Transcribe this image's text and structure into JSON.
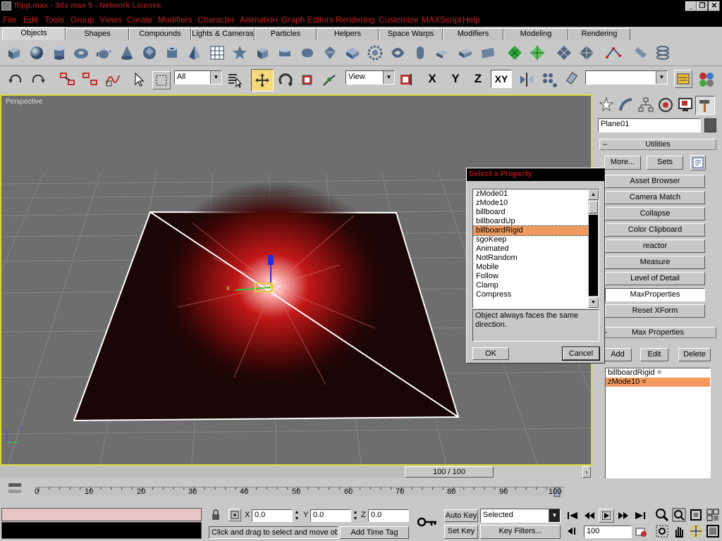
{
  "window": {
    "title": "flipp.max - 3ds max 5 - Network License",
    "min": "_",
    "restore": "❐",
    "close": "✕"
  },
  "menu": [
    "File",
    "Edit",
    "Tools",
    "Group",
    "Views",
    "Create",
    "Modifiers",
    "Character",
    "Animation",
    "Graph Editors",
    "Rendering",
    "Customize",
    "MAXScript",
    "Help"
  ],
  "tabs": [
    "Objects",
    "Shapes",
    "Compounds",
    "Lights & Cameras",
    "Particles",
    "Helpers",
    "Space Warps",
    "Modifiers",
    "Modeling",
    "Rendering"
  ],
  "toolbar": {
    "selection_filter": "All",
    "coord_system": "View",
    "axis_x": "X",
    "axis_y": "Y",
    "axis_z": "Z",
    "axis_xy": "XY",
    "named_selection": ""
  },
  "viewport": {
    "label": "Perspective"
  },
  "command_panel": {
    "object_name": "Plane01",
    "utilities_title": "Utilities",
    "more_label": "More...",
    "sets_label": "Sets",
    "utilities": [
      "Asset Browser",
      "Camera Match",
      "Collapse",
      "Color Clipboard",
      "reactor",
      "Measure",
      "Level of Detail",
      "MaxProperties",
      "Reset XForm"
    ],
    "maxprops_title": "Max Properties",
    "add_label": "Add",
    "edit_label": "Edit",
    "delete_label": "Delete",
    "assigned": [
      "billboardRigid =",
      "zMode10 ="
    ]
  },
  "dialog": {
    "title": "Select a Property",
    "items": [
      "zMode01",
      "zMode10",
      "billboard",
      "billboardUp",
      "billboardRigid",
      "sgoKeep",
      "Animated",
      "NotRandom",
      "Mobile",
      "Follow",
      "Clamp",
      "Compress"
    ],
    "selected": "billboardRigid",
    "description": "Object always faces the same direction.",
    "ok": "OK",
    "cancel": "Cancel"
  },
  "timeline": {
    "frame": "100 / 100",
    "ticks": [
      "0",
      "10",
      "20",
      "30",
      "40",
      "50",
      "60",
      "70",
      "80",
      "90",
      "100"
    ],
    "position_fraction": 1.0
  },
  "status": {
    "prompt": "Click and drag to select and move obj",
    "add_time_tag": "Add Time Tag",
    "x_label": "X",
    "x": "0.0",
    "y_label": "Y",
    "y": "0.0",
    "z_label": "Z",
    "z": "0.0",
    "auto_key": "Auto Key",
    "set_key": "Set Key",
    "key_mode": "Selected",
    "key_filters": "Key Filters...",
    "current_frame": "100"
  }
}
